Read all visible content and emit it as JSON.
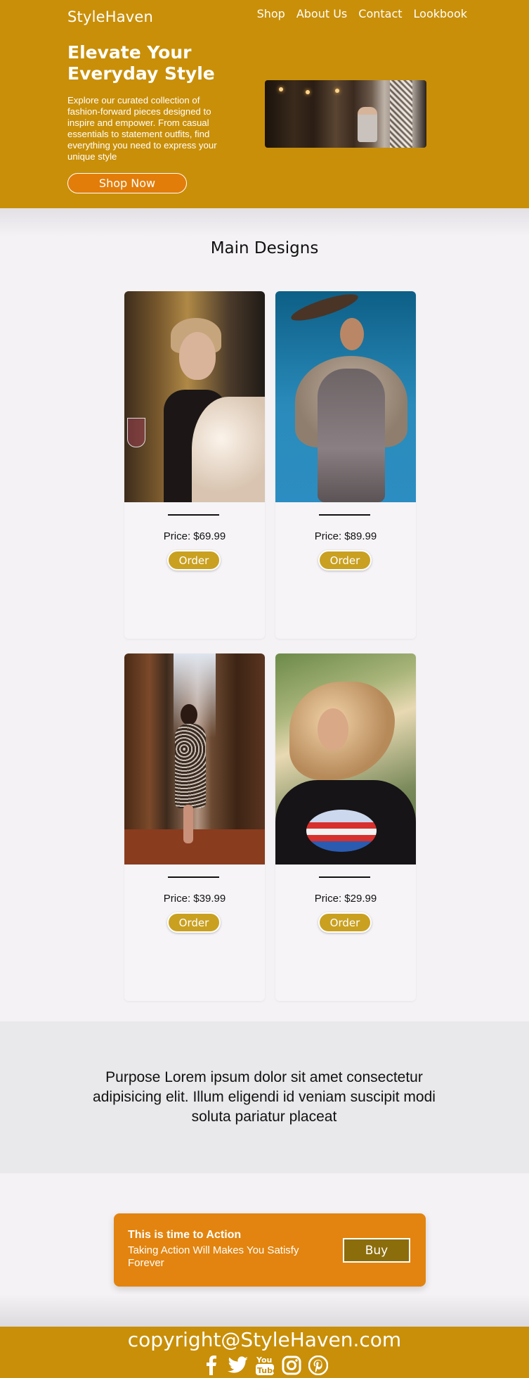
{
  "header": {
    "brand": "StyleHaven",
    "nav": [
      "Shop",
      "About Us",
      "Contact",
      "Lookbook"
    ]
  },
  "hero": {
    "title": "Elevate Your Everyday Style",
    "description": "Explore our curated collection of fashion-forward pieces designed to inspire and empower. From casual essentials to statement outfits, find everything you need to express your unique style",
    "button": "Shop Now"
  },
  "designs": {
    "title": "Main Designs",
    "items": [
      {
        "price": "Price: $69.99",
        "button": "Order"
      },
      {
        "price": "Price: $89.99",
        "button": "Order"
      },
      {
        "price": "Price: $39.99",
        "button": "Order"
      },
      {
        "price": "Price: $29.99",
        "button": "Order"
      }
    ]
  },
  "purpose": {
    "text": "Purpose Lorem ipsum dolor sit amet consectetur adipisicing elit. Illum eligendi id veniam suscipit modi soluta pariatur placeat"
  },
  "cta": {
    "title": "This is time to Action",
    "subtitle": "Taking Action Will Makes You Satisfy Forever",
    "button": "Buy"
  },
  "footer": {
    "copyright": "copyright@StyleHaven.com",
    "socials": [
      "facebook-icon",
      "twitter-icon",
      "youtube-icon",
      "instagram-icon",
      "pinterest-icon"
    ]
  },
  "colors": {
    "header_bg": "#c98f08",
    "shop_button": "#e27d0a",
    "order_button": "#c9a020",
    "cta_bg": "#e2840f",
    "buy_button": "#8b6d0c"
  }
}
